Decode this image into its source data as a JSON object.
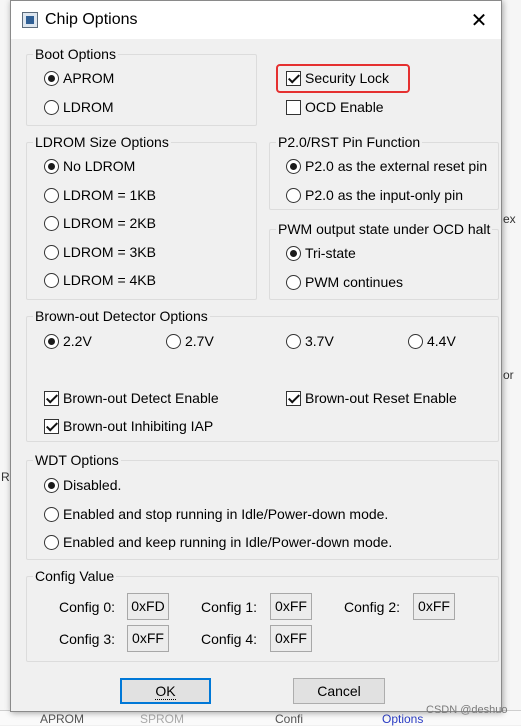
{
  "dialog": {
    "title": "Chip Options",
    "close_glyph": "✕"
  },
  "boot_options": {
    "legend": "Boot Options",
    "items": [
      {
        "label": "APROM",
        "selected": true
      },
      {
        "label": "LDROM",
        "selected": false
      }
    ]
  },
  "security": {
    "security_lock": {
      "label": "Security Lock",
      "checked": true
    },
    "ocd_enable": {
      "label": "OCD Enable",
      "checked": false
    },
    "highlight_color": "#e53030"
  },
  "ldrom_size": {
    "legend": "LDROM Size Options",
    "items": [
      {
        "label": "No LDROM",
        "selected": true
      },
      {
        "label": "LDROM = 1KB",
        "selected": false
      },
      {
        "label": "LDROM = 2KB",
        "selected": false
      },
      {
        "label": "LDROM = 3KB",
        "selected": false
      },
      {
        "label": "LDROM = 4KB",
        "selected": false
      }
    ]
  },
  "p20_rst": {
    "legend": "P2.0/RST Pin Function",
    "items": [
      {
        "label": "P2.0 as the external reset pin",
        "selected": true
      },
      {
        "label": "P2.0 as the input-only pin",
        "selected": false
      }
    ]
  },
  "pwm_state": {
    "legend": "PWM output state under OCD halt",
    "items": [
      {
        "label": "Tri-state",
        "selected": true
      },
      {
        "label": "PWM continues",
        "selected": false
      }
    ]
  },
  "brownout": {
    "legend": "Brown-out Detector Options",
    "voltages": [
      {
        "label": "2.2V",
        "selected": true
      },
      {
        "label": "2.7V",
        "selected": false
      },
      {
        "label": "3.7V",
        "selected": false
      },
      {
        "label": "4.4V",
        "selected": false
      }
    ],
    "detect_enable": {
      "label": "Brown-out Detect Enable",
      "checked": true
    },
    "reset_enable": {
      "label": "Brown-out Reset Enable",
      "checked": true
    },
    "inhibiting_iap": {
      "label": "Brown-out Inhibiting IAP",
      "checked": true
    }
  },
  "wdt": {
    "legend": "WDT Options",
    "items": [
      {
        "label": "Disabled.",
        "selected": true
      },
      {
        "label": "Enabled and stop running in Idle/Power-down mode.",
        "selected": false
      },
      {
        "label": "Enabled and keep running in Idle/Power-down mode.",
        "selected": false
      }
    ]
  },
  "config_value": {
    "legend": "Config Value",
    "items": [
      {
        "label": "Config 0:",
        "value": "0xFD"
      },
      {
        "label": "Config 1:",
        "value": "0xFF"
      },
      {
        "label": "Config 2:",
        "value": "0xFF"
      },
      {
        "label": "Config 3:",
        "value": "0xFF"
      },
      {
        "label": "Config 4:",
        "value": "0xFF"
      }
    ]
  },
  "buttons": {
    "ok": "OK",
    "cancel": "Cancel"
  },
  "background": {
    "right_edge_marks": [
      "ex",
      "or"
    ],
    "left_edge_marks": [
      "R"
    ],
    "bottom_items": [
      "APROM",
      "SPROM",
      "Confi",
      "Options"
    ]
  },
  "watermark": "CSDN @deshuo"
}
